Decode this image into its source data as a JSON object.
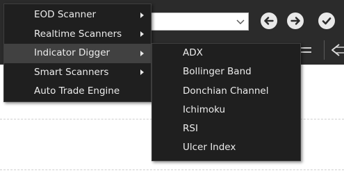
{
  "main_menu": {
    "items": [
      {
        "label": "EOD Scanner",
        "has_submenu": true,
        "highlighted": false
      },
      {
        "label": "Realtime Scanners",
        "has_submenu": true,
        "highlighted": false
      },
      {
        "label": "Indicator Digger",
        "has_submenu": true,
        "highlighted": true
      },
      {
        "label": "Smart Scanners",
        "has_submenu": true,
        "highlighted": false
      },
      {
        "label": "Auto Trade Engine",
        "has_submenu": false,
        "highlighted": false
      }
    ]
  },
  "indicator_submenu": {
    "items": [
      {
        "label": "ADX"
      },
      {
        "label": "Bollinger Band"
      },
      {
        "label": "Donchian Channel"
      },
      {
        "label": "Ichimoku"
      },
      {
        "label": "RSI"
      },
      {
        "label": "Ulcer Index"
      }
    ]
  },
  "toolbar": {
    "combo_value": "",
    "buttons": {
      "back_icon": "arrow-left-icon",
      "forward_icon": "arrow-right-icon",
      "ok_icon": "checkmark-icon"
    }
  },
  "colors": {
    "menu_background": "#1f1f1f",
    "menu_highlight": "#414141",
    "menu_text": "#ececec",
    "toolbar_background": "#2b2b2b"
  }
}
